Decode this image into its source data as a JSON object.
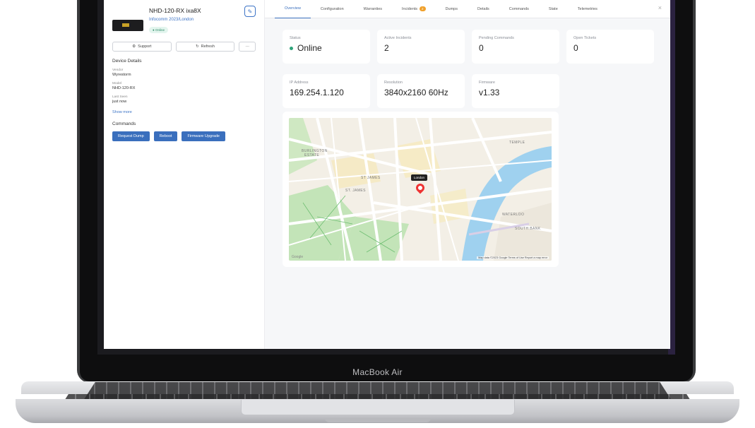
{
  "laptop": {
    "brand": "MacBook Air"
  },
  "device": {
    "title": "NHD-120-RX ixa8X",
    "link": "Infocomm 2023/London",
    "status_badge": "Online",
    "edit_icon": "pencil-icon"
  },
  "actions": {
    "support_label": "Support",
    "refresh_label": "Refresh",
    "more_label": "···"
  },
  "details": {
    "heading": "Device Details",
    "vendor_label": "Vendor",
    "vendor_value": "Wyrestorm",
    "model_label": "Model",
    "model_value": "NHD-120-RX",
    "last_seen_label": "Last Seen",
    "last_seen_value": "just now",
    "show_more": "Show more"
  },
  "commands": {
    "heading": "Commands",
    "request_dump": "Request Dump",
    "reboot": "Reboot",
    "firmware_upgrade": "Firmware Upgrade"
  },
  "tabs": {
    "overview": "Overview",
    "configuration": "Configuration",
    "warranties": "Warranties",
    "incidents": "Incidents",
    "incidents_count": "2",
    "dumps": "Dumps",
    "details": "Details",
    "commands": "Commands",
    "state": "State",
    "telemetries": "Telemetries",
    "close": "×"
  },
  "stats": {
    "status_label": "Status",
    "status_value": "Online",
    "active_incidents_label": "Active Incidents",
    "active_incidents_value": "2",
    "pending_commands_label": "Pending Commands",
    "pending_commands_value": "0",
    "open_tickets_label": "Open Tickets",
    "open_tickets_value": "0",
    "ip_label": "IP Address",
    "ip_value": "169.254.1.120",
    "resolution_label": "Resolution",
    "resolution_value": "3840x2160 60Hz",
    "firmware_label": "Firmware",
    "firmware_value": "v1.33"
  },
  "map": {
    "pin_label": "London",
    "labels": {
      "burlington": "BURLINGTON",
      "estate": "ESTATE",
      "st_james": "ST JAMES",
      "st_jamess": "ST. JAMES",
      "temple": "TEMPLE",
      "waterloo": "WATERLOO",
      "south_bank": "SOUTH BANK"
    },
    "google": "Google",
    "attribution": "Map data ©2023 Google   Terms of Use   Report a map error"
  },
  "colors": {
    "accent": "#3a6fbd",
    "online": "#2fa37a",
    "incident_badge": "#f0a02b",
    "river": "#9fd1ef",
    "park": "#c3e4b8"
  }
}
